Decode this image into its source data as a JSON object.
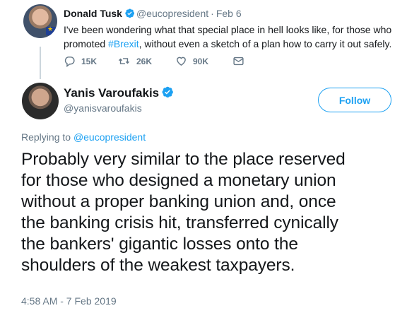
{
  "parent_tweet": {
    "name": "Donald Tusk",
    "handle": "@eucopresident",
    "separator": "·",
    "date": "Feb 6",
    "text_before": "I've been wondering what that special place in hell looks like, for those who promoted ",
    "hashtag": "#Brexit",
    "text_after": ", without even a sketch of a plan how to carry it out safely.",
    "replies": "15K",
    "retweets": "26K",
    "likes": "90K",
    "icons": [
      "reply-icon",
      "retweet-icon",
      "like-icon",
      "message-icon"
    ]
  },
  "main_tweet": {
    "name": "Yanis Varoufakis",
    "handle": "@yanisvaroufakis",
    "follow_label": "Follow",
    "replying_prefix": "Replying to ",
    "replying_handle": "@eucopresident",
    "text_lines": [
      "Probably very similar to the place reserved",
      "for those who designed a monetary union",
      "without a proper banking union and, once",
      "the banking crisis hit, transferred cynically",
      "the bankers' gigantic losses onto the",
      "shoulders of the weakest taxpayers."
    ],
    "timestamp": "4:58 AM - 7 Feb 2019"
  },
  "colors": {
    "accent": "#1da1f2",
    "muted": "#657786",
    "text": "#14171a",
    "thread_line": "#ccd6dd"
  }
}
